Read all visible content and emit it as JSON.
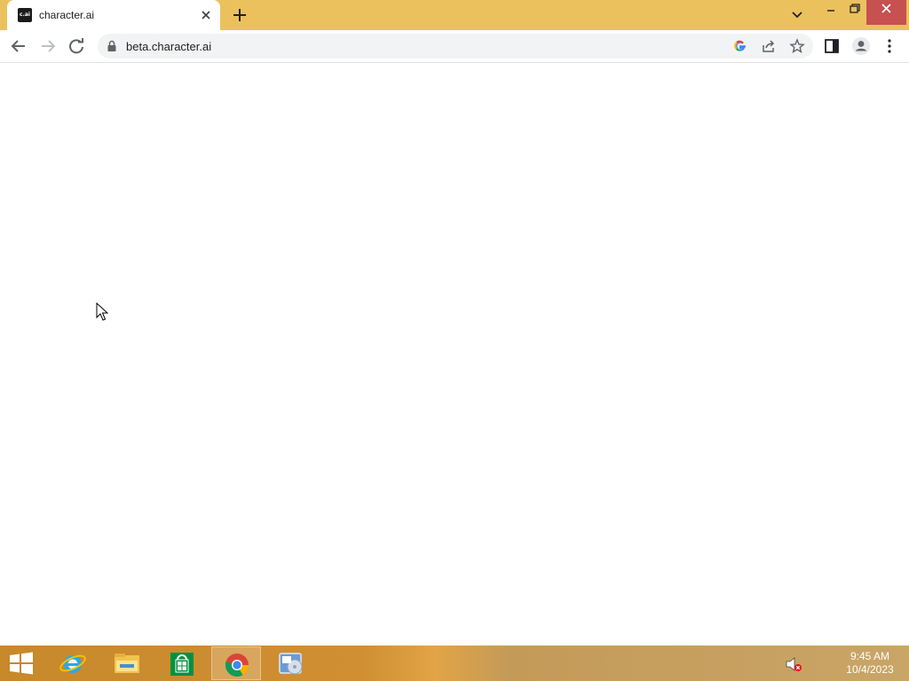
{
  "browser": {
    "tab": {
      "favicon_text": "c.ai",
      "title": "character.ai"
    },
    "url": "beta.character.ai",
    "colors": {
      "titlebar": "#ebc15e",
      "close_button": "#c75050"
    }
  },
  "taskbar": {
    "apps": [
      {
        "name": "Internet Explorer",
        "icon": "ie-icon"
      },
      {
        "name": "File Explorer",
        "icon": "folder-icon"
      },
      {
        "name": "Store",
        "icon": "store-icon"
      },
      {
        "name": "Google Chrome",
        "icon": "chrome-icon",
        "active": true
      },
      {
        "name": "Media Player",
        "icon": "media-icon"
      }
    ],
    "clock": {
      "time": "9:45 AM",
      "date": "10/4/2023"
    }
  }
}
